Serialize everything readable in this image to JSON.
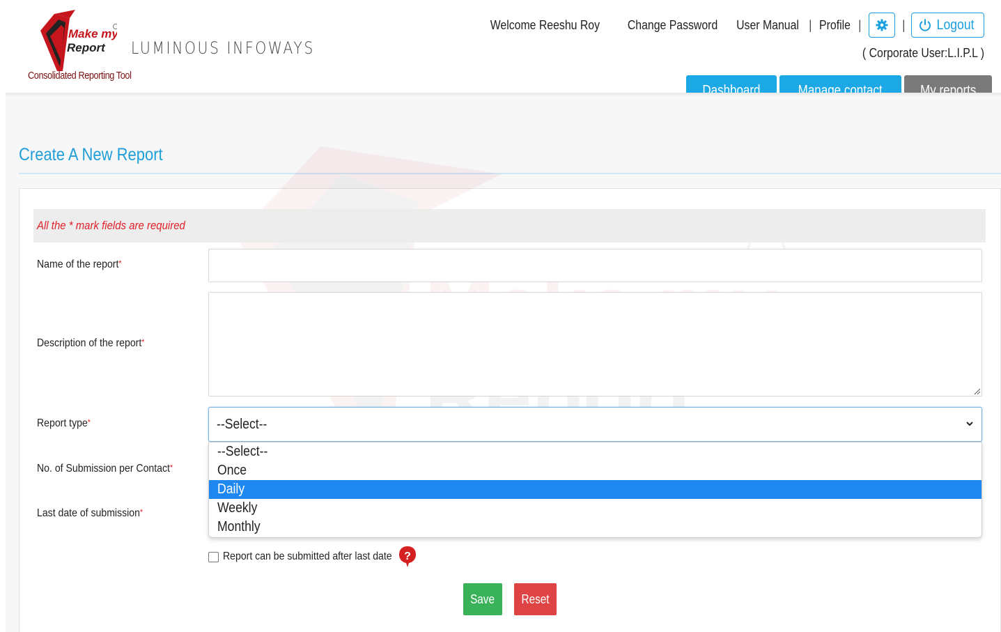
{
  "header": {
    "brand_line1": "Make my",
    "brand_line2": "Report",
    "tagline": "Consolidated Reporting Tool",
    "company": "LUMINOUS INFOWAYS",
    "welcome": "Welcome Reeshu Roy",
    "change_password": "Change Password",
    "user_manual": "User Manual",
    "profile": "Profile",
    "separator": "|",
    "logout": "Logout",
    "corporate_user": "( Corporate User:L.I.P.L )"
  },
  "nav": {
    "dashboard": "Dashboard",
    "manage_contact": "Manage contact",
    "my_reports": "My reports"
  },
  "page": {
    "title": "Create A New Report",
    "required_note": "All the * mark fields are required"
  },
  "form": {
    "name_label": "Name of the report",
    "name_value": "",
    "description_label": "Description of the report",
    "description_value": "",
    "report_type_label": "Report type",
    "report_type_selected": "--Select--",
    "report_type_options": [
      "--Select--",
      "Once",
      "Daily",
      "Weekly",
      "Monthly"
    ],
    "report_type_highlighted": "Daily",
    "submissions_label": "No. of Submission per Contact",
    "last_date_label": "Last date of submission",
    "required_star": "*",
    "after_last_date_label": "Report can be submitted after last date",
    "after_last_date_checked": false,
    "save_label": "Save",
    "reset_label": "Reset"
  },
  "watermark": {
    "line1": "Make my",
    "line2": "Report"
  },
  "colors": {
    "primary": "#1ba8e4",
    "title": "#1f9ed9",
    "required": "#e0202a",
    "save": "#3ab25a",
    "reset": "#df4444",
    "highlight": "#1e88f0",
    "brand_red": "#c4161c"
  },
  "icons": {
    "gear": "gear-icon",
    "logout": "power-icon",
    "dropdown": "chevron-down-icon",
    "help": "help-icon"
  }
}
